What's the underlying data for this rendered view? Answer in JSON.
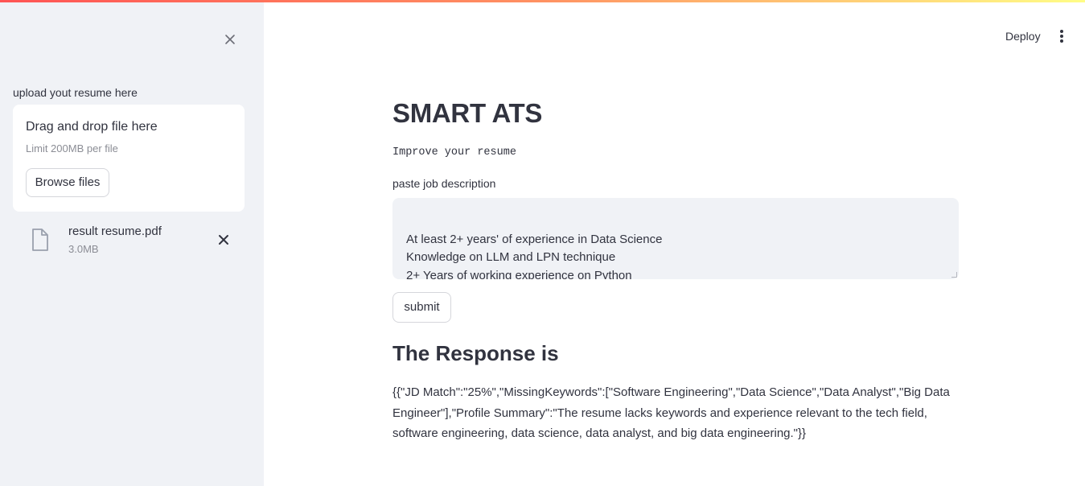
{
  "sidebar": {
    "close_icon": "close-icon",
    "upload_label": "upload yout resume here",
    "dropzone": {
      "title": "Drag and drop file here",
      "limit": "Limit 200MB per file",
      "browse_label": "Browse files"
    },
    "file": {
      "icon": "file-icon",
      "name": "result resume.pdf",
      "size": "3.0MB",
      "remove_icon": "close-icon"
    }
  },
  "header": {
    "deploy_label": "Deploy",
    "menu_icon": "more-vertical-icon"
  },
  "main": {
    "title": "SMART ATS",
    "subtitle": "Improve your resume",
    "jd_label": "paste job description",
    "jd_value": "At least 2+ years' of experience in Data Science\nKnowledge on LLM and LPN technique\n2+ Years of working experience on Python",
    "submit_label": "submit",
    "response_heading": "The Response is",
    "response_text": "{{\"JD Match\":\"25%\",\"MissingKeywords\":[\"Software Engineering\",\"Data Science\",\"Data Analyst\",\"Big Data Engineer\"],\"Profile Summary\":\"The resume lacks keywords and experience relevant to the tech field, software engineering, data science, data analyst, and big data engineering.\"}}"
  },
  "colors": {
    "sidebar_bg": "#f0f2f6",
    "text": "#31333f",
    "muted": "#8b8d95",
    "accent_start": "#ff4b4b",
    "accent_end": "#fffd80"
  }
}
